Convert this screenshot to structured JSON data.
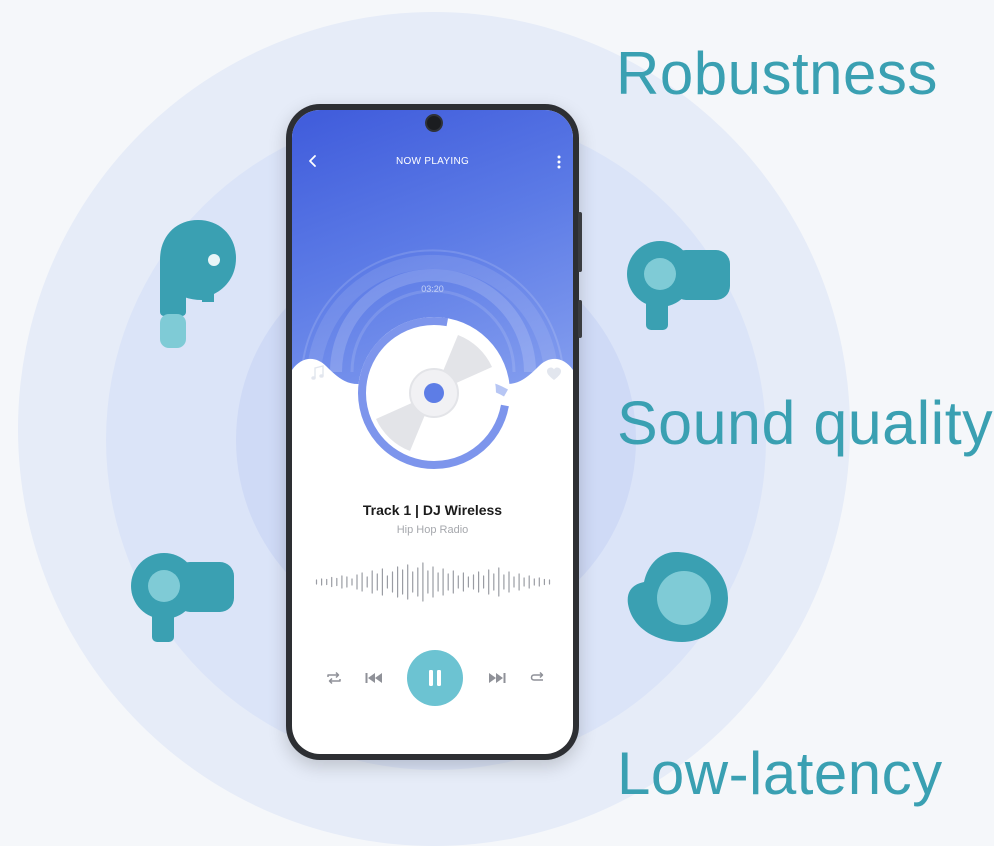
{
  "features": {
    "robustness": "Robustness",
    "sound_quality": "Sound quality",
    "low_latency": "Low-latency"
  },
  "player": {
    "title": "NOW PLAYING",
    "time": "03:20",
    "track": "Track 1 | DJ Wireless",
    "station": "Hip Hop Radio"
  },
  "icons": {
    "back": "chevron-left-icon",
    "menu": "more-vertical-icon",
    "note": "music-note-icon",
    "heart": "heart-icon",
    "repeat": "repeat-icon",
    "previous": "skip-previous-icon",
    "pause": "pause-icon",
    "next": "skip-next-icon",
    "loop": "loop-icon"
  },
  "colors": {
    "accent": "#3aa0b2",
    "screen_blue": "#4a68de",
    "play_button": "#6cc3d2"
  }
}
